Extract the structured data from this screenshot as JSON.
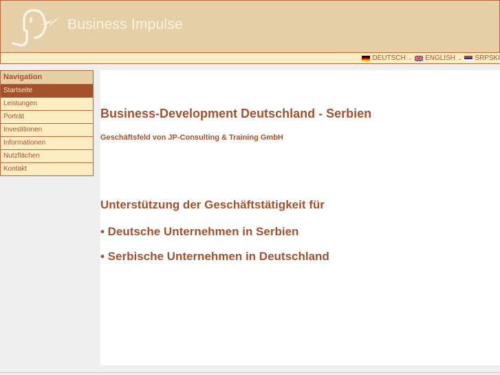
{
  "header": {
    "brand": "Business Impulse",
    "logo": "jp-elephant-logo"
  },
  "languages": [
    {
      "label": "DEUTSCH",
      "flag": "de-flag"
    },
    {
      "label": "ENGLISH",
      "flag": "uk-flag"
    },
    {
      "label": "SRPSKI",
      "flag": "rs-flag"
    }
  ],
  "lang_separator": "-",
  "nav": {
    "heading": "Navigation",
    "items": [
      {
        "label": "Startseite",
        "active": true
      },
      {
        "label": "Leistungen"
      },
      {
        "label": "Porträt"
      },
      {
        "label": "Investitionen"
      },
      {
        "label": "Informationen"
      },
      {
        "label": "Nutzflächen"
      },
      {
        "label": "Kontakt"
      }
    ]
  },
  "main": {
    "title": "Business-Development Deutschland - Serbien",
    "subtitle": "Geschäftsfeld von JP-Consulting & Training GmbH",
    "support_heading": "Unterstützung der Geschäftstätigkeit für",
    "bullets": [
      "• Deutsche Unternehmen in Serbien",
      "• Serbische Unternehmen in Deutschland"
    ]
  },
  "colors": {
    "accent": "#a4502c",
    "header_bg": "#e4cfa6",
    "nav_bg": "#fdedc3"
  }
}
